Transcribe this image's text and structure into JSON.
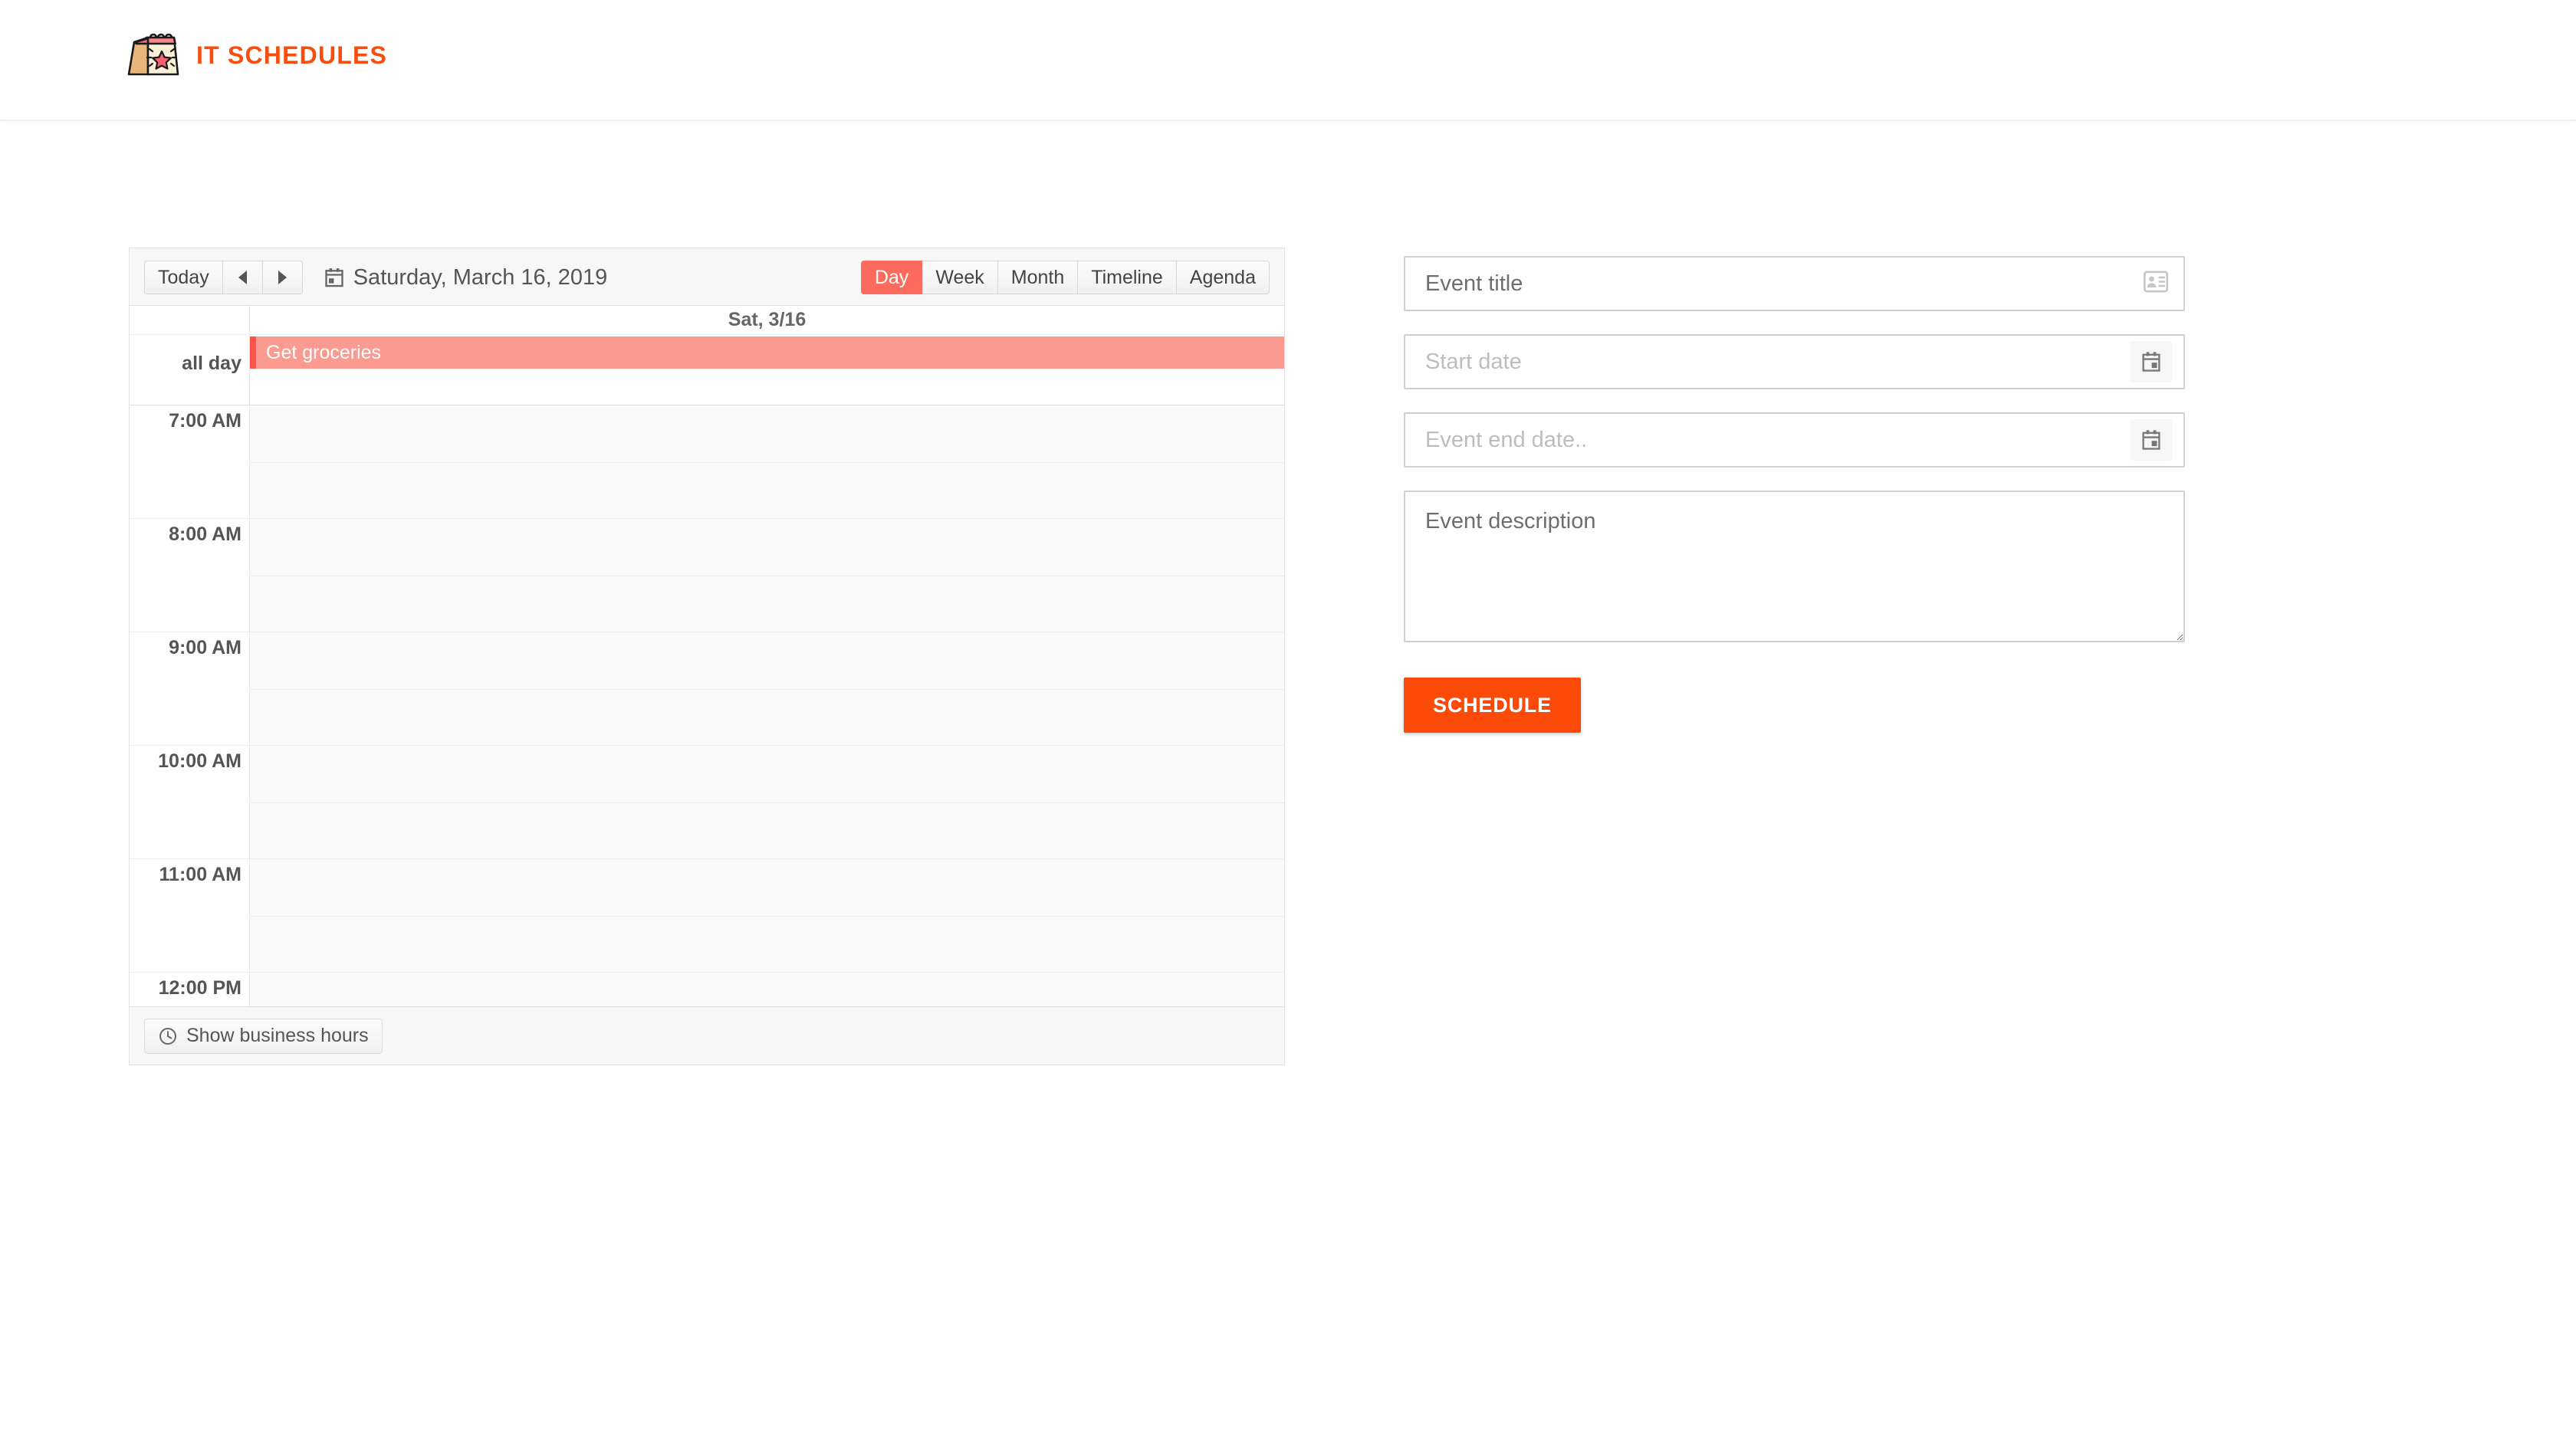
{
  "header": {
    "brand_title": "IT SCHEDULES",
    "logo_icon": "desk-calendar-star-icon"
  },
  "calendar": {
    "toolbar": {
      "today_label": "Today",
      "prev_icon": "arrow-left-icon",
      "next_icon": "arrow-right-icon",
      "date_icon": "calendar-icon",
      "current_date": "Saturday, March 16, 2019",
      "views": [
        {
          "label": "Day",
          "active": true
        },
        {
          "label": "Week",
          "active": false
        },
        {
          "label": "Month",
          "active": false
        },
        {
          "label": "Timeline",
          "active": false
        },
        {
          "label": "Agenda",
          "active": false
        }
      ],
      "active_view_color": "#FD6A5E"
    },
    "day_header": "Sat, 3/16",
    "all_day_label": "all day",
    "events": [
      {
        "title": "Get groceries",
        "all_day": true,
        "bg_color": "#FB9A90",
        "accent_color": "#FB554A"
      }
    ],
    "time_slots": [
      "7:00 AM",
      "8:00 AM",
      "9:00 AM",
      "10:00 AM",
      "11:00 AM",
      "12:00 PM"
    ],
    "footer": {
      "business_hours_label": "Show business hours",
      "clock_icon": "clock-icon"
    }
  },
  "form": {
    "title_field": {
      "placeholder": "Event title",
      "value": "",
      "icon": "contact-card-icon"
    },
    "start_date_field": {
      "placeholder": "Start date",
      "value": "",
      "icon": "calendar-picker-icon"
    },
    "end_date_field": {
      "placeholder": "Event end date..",
      "value": "",
      "icon": "calendar-picker-icon"
    },
    "description_field": {
      "placeholder": "Event description",
      "value": ""
    },
    "submit_label": "SCHEDULE",
    "submit_color": "#FC4A08"
  }
}
